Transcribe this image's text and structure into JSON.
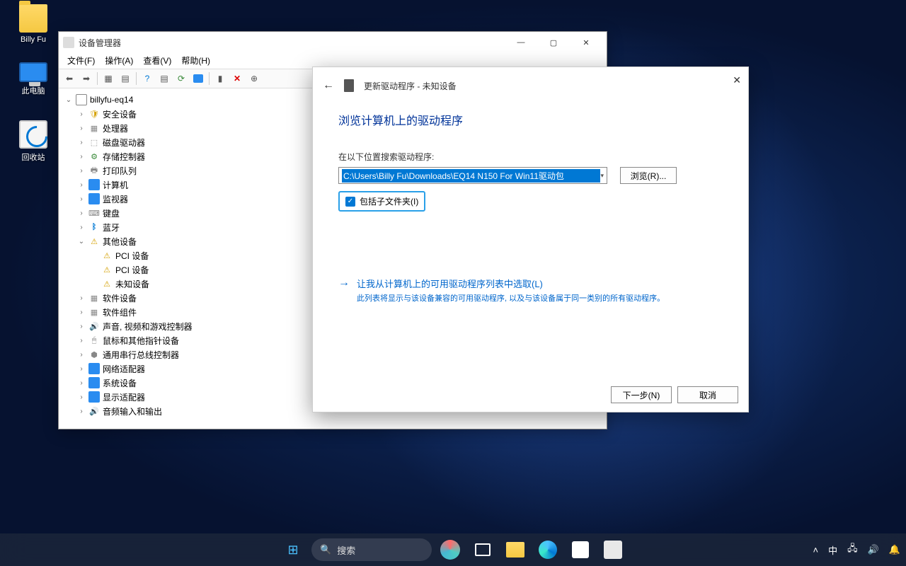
{
  "desktop": {
    "icons": [
      {
        "label": "Billy Fu",
        "type": "folder"
      },
      {
        "label": "此电脑",
        "type": "pc"
      },
      {
        "label": "回收站",
        "type": "bin"
      }
    ]
  },
  "device_manager": {
    "title": "设备管理器",
    "menu": [
      "文件(F)",
      "操作(A)",
      "查看(V)",
      "帮助(H)"
    ],
    "root": "billyfu-eq14",
    "categories": [
      {
        "label": "安全设备",
        "icon": "shield"
      },
      {
        "label": "处理器",
        "icon": "chip"
      },
      {
        "label": "磁盘驱动器",
        "icon": "disk"
      },
      {
        "label": "存储控制器",
        "icon": "ctrl"
      },
      {
        "label": "打印队列",
        "icon": "print"
      },
      {
        "label": "计算机",
        "icon": "monitor"
      },
      {
        "label": "监视器",
        "icon": "monitor"
      },
      {
        "label": "键盘",
        "icon": "kb"
      },
      {
        "label": "蓝牙",
        "icon": "bt"
      },
      {
        "label": "其他设备",
        "icon": "warn",
        "expanded": true,
        "children": [
          {
            "label": "PCI 设备",
            "icon": "warn"
          },
          {
            "label": "PCI 设备",
            "icon": "warn"
          },
          {
            "label": "未知设备",
            "icon": "warn"
          }
        ]
      },
      {
        "label": "软件设备",
        "icon": "chip"
      },
      {
        "label": "软件组件",
        "icon": "chip"
      },
      {
        "label": "声音, 视频和游戏控制器",
        "icon": "sound"
      },
      {
        "label": "鼠标和其他指针设备",
        "icon": "mouse"
      },
      {
        "label": "通用串行总线控制器",
        "icon": "usb"
      },
      {
        "label": "网络适配器",
        "icon": "net"
      },
      {
        "label": "系统设备",
        "icon": "sys"
      },
      {
        "label": "显示适配器",
        "icon": "monitor"
      },
      {
        "label": "音频输入和输出",
        "icon": "sound"
      }
    ]
  },
  "wizard": {
    "title": "更新驱动程序 - 未知设备",
    "heading": "浏览计算机上的驱动程序",
    "search_label": "在以下位置搜索驱动程序:",
    "path": "C:\\Users\\Billy Fu\\Downloads\\EQ14 N150 For Win11驱动包",
    "browse": "浏览(R)...",
    "include_sub": "包括子文件夹(I)",
    "option_title": "让我从计算机上的可用驱动程序列表中选取(L)",
    "option_desc": "此列表将显示与该设备兼容的可用驱动程序, 以及与该设备属于同一类别的所有驱动程序。",
    "next": "下一步(N)",
    "cancel": "取消"
  },
  "taskbar": {
    "search_placeholder": "搜索",
    "ime": "中"
  }
}
